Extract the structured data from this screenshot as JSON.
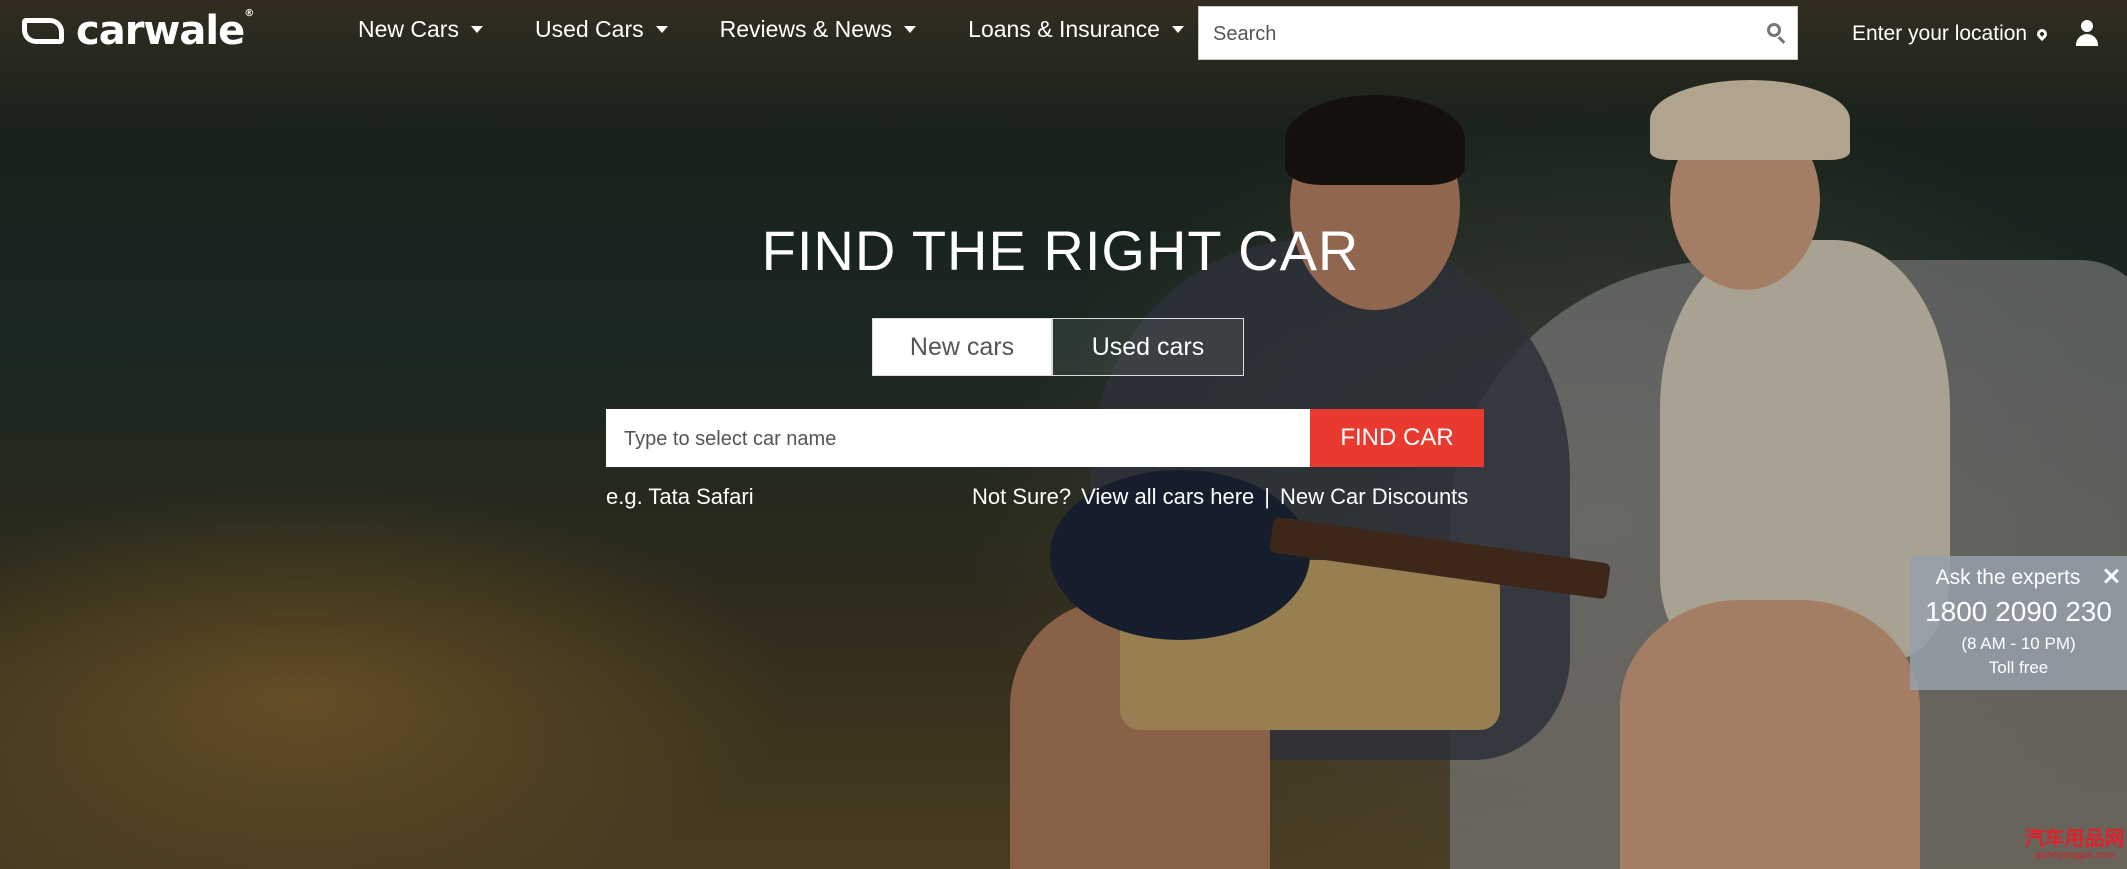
{
  "header": {
    "logo_text": "carwale",
    "logo_tm": "®",
    "nav": [
      {
        "label": "New Cars"
      },
      {
        "label": "Used Cars"
      },
      {
        "label": "Reviews & News"
      },
      {
        "label": "Loans & Insurance"
      }
    ],
    "search_placeholder": "Search",
    "location_label": "Enter your location"
  },
  "hero": {
    "title": "FIND THE RIGHT CAR",
    "tabs": [
      {
        "label": "New cars",
        "active": true
      },
      {
        "label": "Used cars",
        "active": false
      }
    ],
    "car_input_placeholder": "Type to select car name",
    "find_button": "FIND CAR",
    "example_text": "e.g. Tata Safari",
    "not_sure": "Not Sure?",
    "view_all_link": "View all cars here",
    "separator": "|",
    "discounts_link": "New Car Discounts"
  },
  "experts": {
    "title": "Ask the experts",
    "phone": "1800 2090 230",
    "hours": "(8 AM - 10 PM)",
    "toll": "Toll free"
  },
  "watermark": {
    "main": "汽车用品网",
    "sub": "qicheyongpin.com"
  },
  "colors": {
    "accent": "#ea3a2f"
  }
}
